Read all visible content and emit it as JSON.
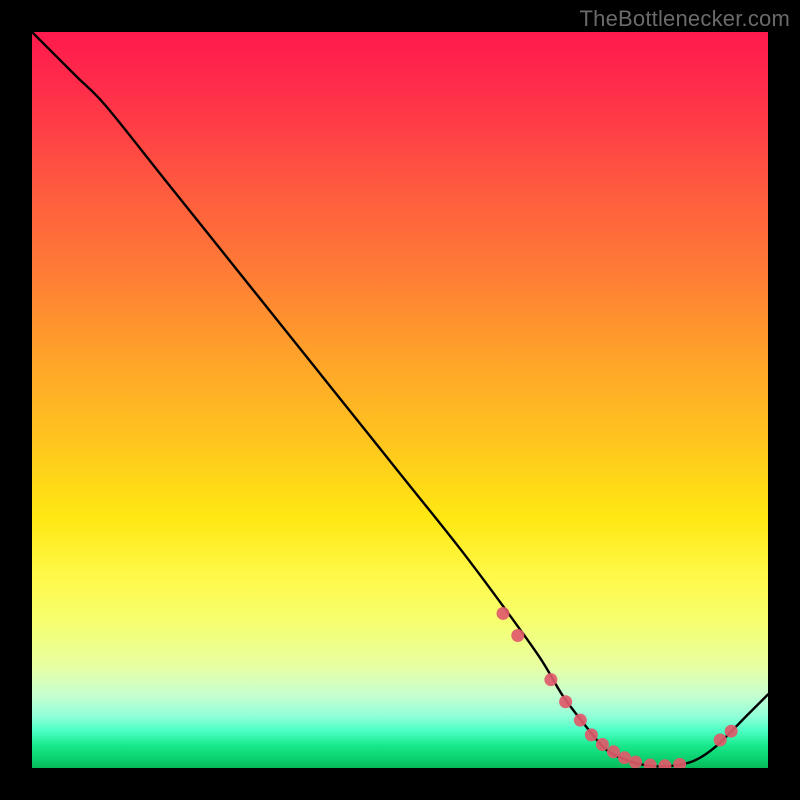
{
  "watermark": "TheBottlenecker.com",
  "chart_data": {
    "type": "line",
    "title": "",
    "xlabel": "",
    "ylabel": "",
    "xlim": [
      0,
      100
    ],
    "ylim": [
      0,
      100
    ],
    "x": [
      0,
      6,
      10,
      18,
      26,
      34,
      42,
      50,
      58,
      64,
      69,
      72,
      75,
      78,
      81,
      84,
      87,
      90,
      93,
      97,
      100
    ],
    "y": [
      100,
      94,
      90,
      80,
      70,
      60,
      50,
      40,
      30,
      22,
      15,
      10,
      6,
      2.5,
      1,
      0.3,
      0.3,
      1,
      3,
      7,
      10
    ],
    "markers": {
      "x": [
        64.0,
        66.0,
        70.5,
        72.5,
        74.5,
        76.0,
        77.5,
        79.0,
        80.5,
        82.0,
        84.0,
        86.0,
        88.0,
        93.5,
        95.0
      ],
      "y": [
        21.0,
        18.0,
        12.0,
        9.0,
        6.5,
        4.5,
        3.2,
        2.2,
        1.4,
        0.8,
        0.4,
        0.3,
        0.5,
        3.8,
        5.0
      ]
    },
    "marker_color": "#e05a6a",
    "line_color": "#000000"
  }
}
